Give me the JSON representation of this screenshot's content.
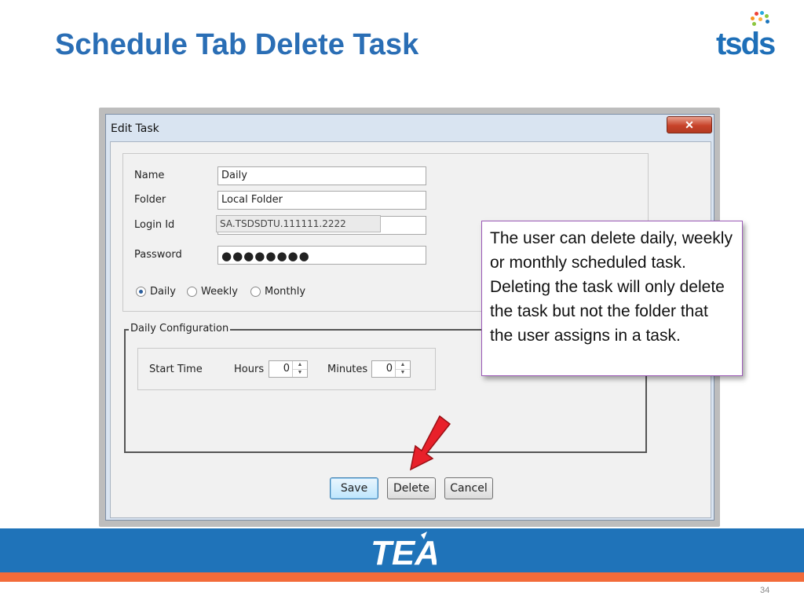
{
  "slide": {
    "title": "Schedule Tab Delete Task",
    "logo_text": "tsds",
    "page_number": "34",
    "callout_text": "The user can delete daily, weekly  or monthly scheduled task.  Deleting the task will only delete the task but not the folder that the user assigns in a task.",
    "footer_logo_text": "TEA"
  },
  "dialog": {
    "title": "Edit Task",
    "close_icon": "✕",
    "fields": {
      "name_label": "Name",
      "name_value": "Daily",
      "folder_label": "Folder",
      "folder_value": "Local Folder",
      "login_label": "Login Id",
      "login_value": "SA.TSDSDTU.111111.2222",
      "password_label": "Password",
      "password_value": "●●●●●●●●"
    },
    "frequency": {
      "options": [
        "Daily",
        "Weekly",
        "Monthly"
      ],
      "selected": "Daily"
    },
    "config": {
      "legend": "Daily Configuration",
      "start_time_label": "Start Time",
      "hours_label": "Hours",
      "hours_value": "0",
      "minutes_label": "Minutes",
      "minutes_value": "0"
    },
    "buttons": {
      "save": "Save",
      "delete": "Delete",
      "cancel": "Cancel"
    }
  },
  "colors": {
    "title_blue": "#2a6eb5",
    "footer_blue": "#1f73b9",
    "footer_orange": "#f26b3a",
    "arrow_red": "#e8202a",
    "callout_border": "#9b59b6"
  }
}
